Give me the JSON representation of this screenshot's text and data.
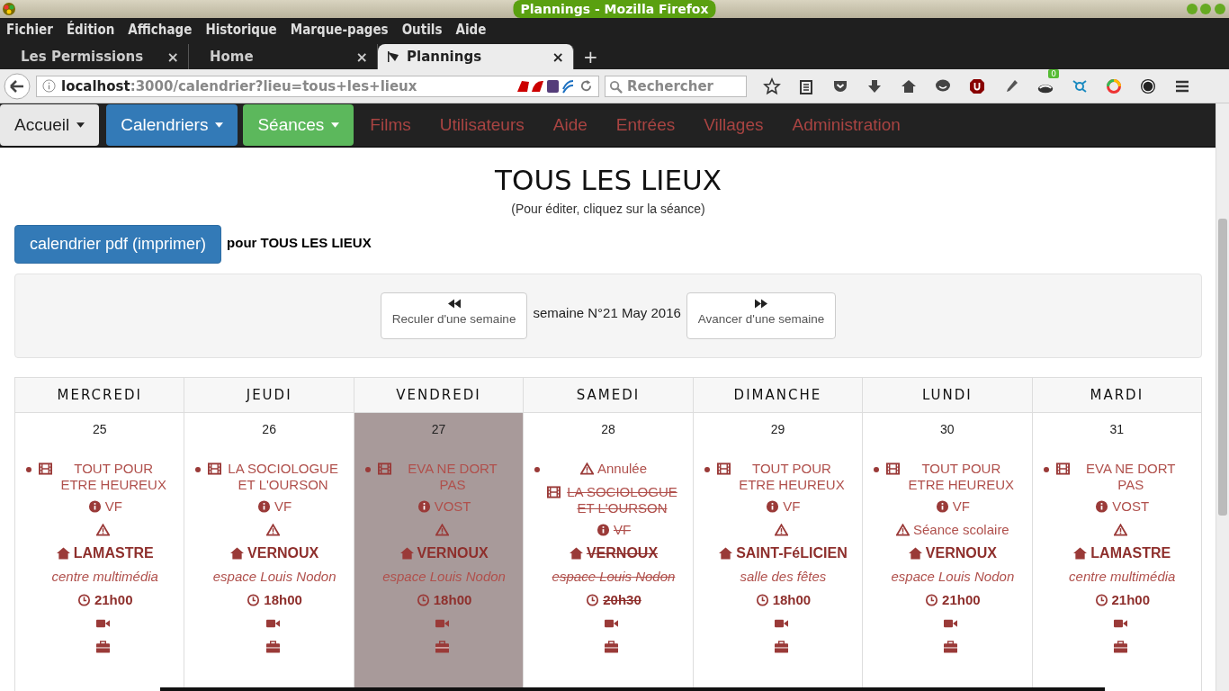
{
  "window": {
    "title": "Plannings - Mozilla Firefox"
  },
  "menu": [
    "Fichier",
    "Édition",
    "Affichage",
    "Historique",
    "Marque-pages",
    "Outils",
    "Aide"
  ],
  "tabs": [
    {
      "label": "Les Permissions",
      "close": "×",
      "selected": false
    },
    {
      "label": "Home",
      "close": "×",
      "selected": false
    },
    {
      "label": "Plannings",
      "close": "×",
      "selected": true
    }
  ],
  "new_tab": "+",
  "url": {
    "host": "localhost",
    "rest": ":3000/calendrier?lieu=tous+les+lieux"
  },
  "search": {
    "placeholder": "Rechercher"
  },
  "toolbar_badge": "0",
  "navbar": [
    {
      "label": "Accueil",
      "kind": "default"
    },
    {
      "label": "Calendriers",
      "kind": "primary"
    },
    {
      "label": "Séances",
      "kind": "success"
    },
    {
      "label": "Films",
      "kind": "link"
    },
    {
      "label": "Utilisateurs",
      "kind": "link"
    },
    {
      "label": "Aide",
      "kind": "link"
    },
    {
      "label": "Entrées",
      "kind": "link"
    },
    {
      "label": "Villages",
      "kind": "link"
    },
    {
      "label": "Administration",
      "kind": "link"
    }
  ],
  "heading": "TOUS LES LIEUX",
  "subtitle": "(Pour éditer, cliquez sur la séance)",
  "pdf_button": "calendrier pdf (imprimer)",
  "pdf_suffix": "pour TOUS LES LIEUX",
  "week_nav": {
    "prev": "Reculer d'une semaine",
    "label": "semaine N°21 May 2016",
    "next": "Avancer d'une semaine"
  },
  "days": [
    {
      "name": "MERCREDI",
      "date": "25",
      "selected": false,
      "events": [
        {
          "cancelled": false,
          "film": "TOUT POUR ETRE HEUREUX",
          "version": "VF",
          "village": "LAMASTRE",
          "venue": "centre multimédia",
          "time": "21h00"
        }
      ]
    },
    {
      "name": "JEUDI",
      "date": "26",
      "selected": false,
      "events": [
        {
          "cancelled": false,
          "film": "LA SOCIOLOGUE ET L'OURSON",
          "version": "VF",
          "village": "VERNOUX",
          "venue": "espace Louis Nodon",
          "time": "18h00"
        }
      ]
    },
    {
      "name": "VENDREDI",
      "date": "27",
      "selected": true,
      "events": [
        {
          "cancelled": false,
          "film": "EVA NE DORT PAS",
          "version": "VOST",
          "village": "VERNOUX",
          "venue": "espace Louis Nodon",
          "time": "18h00"
        }
      ]
    },
    {
      "name": "SAMEDI",
      "date": "28",
      "selected": false,
      "events": [
        {
          "cancelled": true,
          "status": "Annulée",
          "film": "LA SOCIOLOGUE ET L'OURSON",
          "version": "VF",
          "village": "VERNOUX",
          "venue": "espace Louis Nodon",
          "time": "20h30"
        }
      ]
    },
    {
      "name": "DIMANCHE",
      "date": "29",
      "selected": false,
      "events": [
        {
          "cancelled": false,
          "film": "TOUT POUR ETRE HEUREUX",
          "version": "VF",
          "village": "SAINT-FéLICIEN",
          "venue": "salle des fêtes",
          "time": "18h00"
        }
      ]
    },
    {
      "name": "LUNDI",
      "date": "30",
      "selected": false,
      "events": [
        {
          "cancelled": false,
          "film": "TOUT POUR ETRE HEUREUX",
          "version": "VF",
          "note": "Séance scolaire",
          "village": "VERNOUX",
          "venue": "espace Louis Nodon",
          "time": "21h00"
        }
      ]
    },
    {
      "name": "MARDI",
      "date": "31",
      "selected": false,
      "events": [
        {
          "cancelled": false,
          "film": "EVA NE DORT PAS",
          "version": "VOST",
          "village": "LAMASTRE",
          "venue": "centre multimédia",
          "time": "21h00"
        }
      ]
    }
  ]
}
